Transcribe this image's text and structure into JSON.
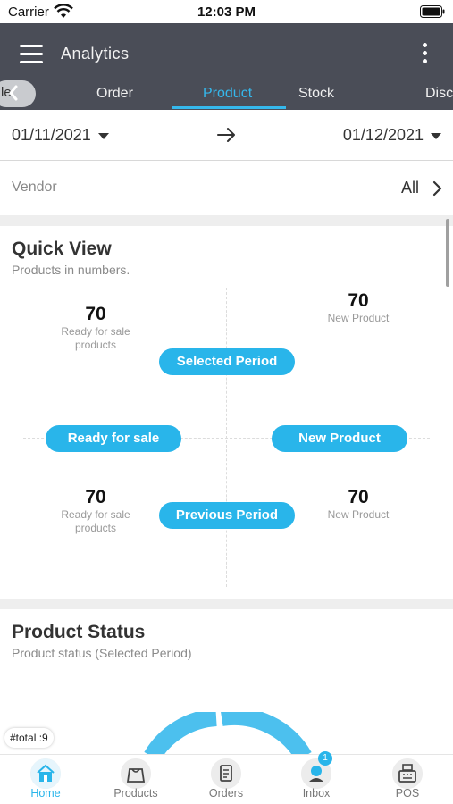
{
  "status_bar": {
    "carrier": "Carrier",
    "time": "12:03 PM"
  },
  "header": {
    "title": "Analytics",
    "menu_icon": "hamburger-icon",
    "more_icon": "kebab-icon"
  },
  "tabs": {
    "back_partial_label": "le",
    "items": [
      {
        "label": "Order"
      },
      {
        "label": "Product",
        "active": true
      },
      {
        "label": "Stock"
      },
      {
        "label": "Disc"
      }
    ]
  },
  "date_range": {
    "from": "01/11/2021",
    "to": "01/12/2021"
  },
  "vendor": {
    "label": "Vendor",
    "value": "All"
  },
  "quick_view": {
    "title": "Quick View",
    "subtitle": "Products in numbers.",
    "selected": {
      "ready_value": "70",
      "ready_label": "Ready for sale products",
      "new_value": "70",
      "new_label": "New Product"
    },
    "previous": {
      "ready_value": "70",
      "ready_label": "Ready for sale products",
      "new_value": "70",
      "new_label": "New Product"
    },
    "pills": {
      "selected_period": "Selected Period",
      "ready_for_sale": "Ready for sale",
      "new_product": "New Product",
      "previous_period": "Previous Period"
    }
  },
  "product_status": {
    "title": "Product Status",
    "subtitle": "Product status (Selected Period)",
    "total_badge": "#total :9"
  },
  "bottom_nav": {
    "items": [
      {
        "label": "Home",
        "icon": "home-icon",
        "active": true
      },
      {
        "label": "Products",
        "icon": "shopping-bag-icon"
      },
      {
        "label": "Orders",
        "icon": "document-icon"
      },
      {
        "label": "Inbox",
        "icon": "inbox-icon",
        "badge": "1"
      },
      {
        "label": "POS",
        "icon": "cash-register-icon"
      }
    ]
  },
  "colors": {
    "header_bg": "#4a4d57",
    "accent": "#29b5ea",
    "tab_active": "#35b8ec"
  }
}
